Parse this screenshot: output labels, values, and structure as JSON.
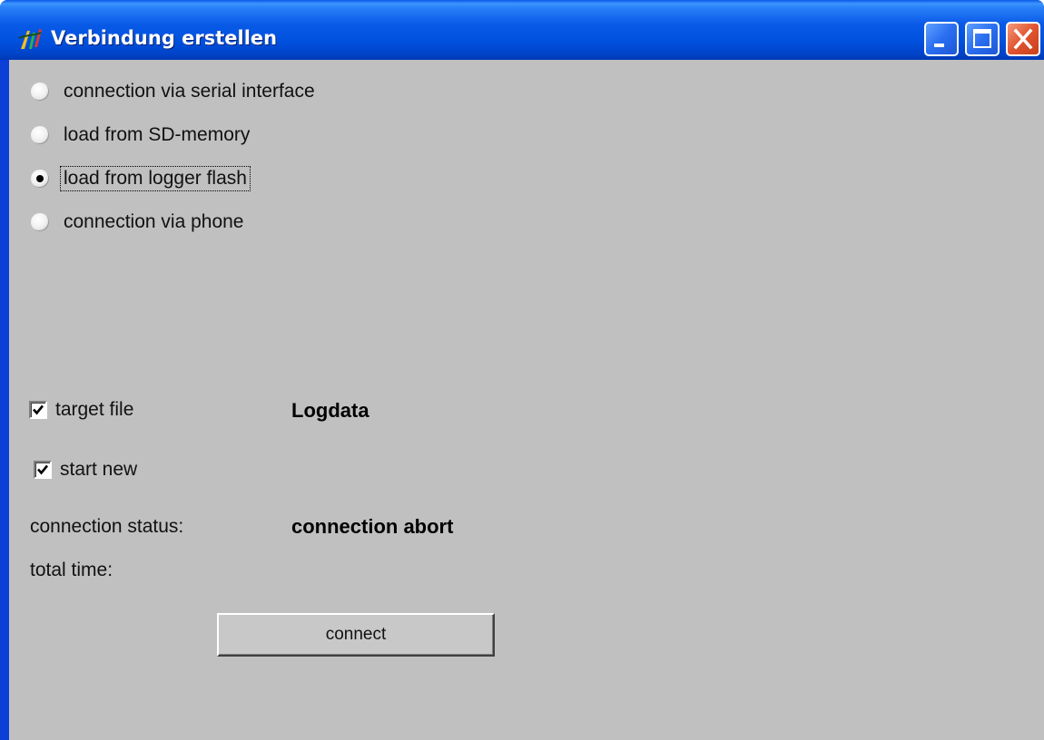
{
  "window": {
    "title": "Verbindung erstellen",
    "icon": "app-logo-icon",
    "controls": [
      "minimize-icon",
      "maximize-icon",
      "close-icon"
    ]
  },
  "connection_options": [
    {
      "label": "connection via serial interface",
      "checked": false
    },
    {
      "label": "load from SD-memory",
      "checked": false
    },
    {
      "label": "load from logger flash",
      "checked": true
    },
    {
      "label": "connection via phone",
      "checked": false
    }
  ],
  "target_file": {
    "label": "target file",
    "checked": true,
    "value": "Logdata"
  },
  "start_new": {
    "label": "start new",
    "checked": true
  },
  "status": {
    "label": "connection status:",
    "value": "connection abort"
  },
  "total_time": {
    "label": "total time:"
  },
  "connect_button": {
    "label": "connect"
  },
  "colors": {
    "titlebar": "#0a5ae8",
    "client_background": "#c0c0c0",
    "close_button": "#e0542f"
  }
}
